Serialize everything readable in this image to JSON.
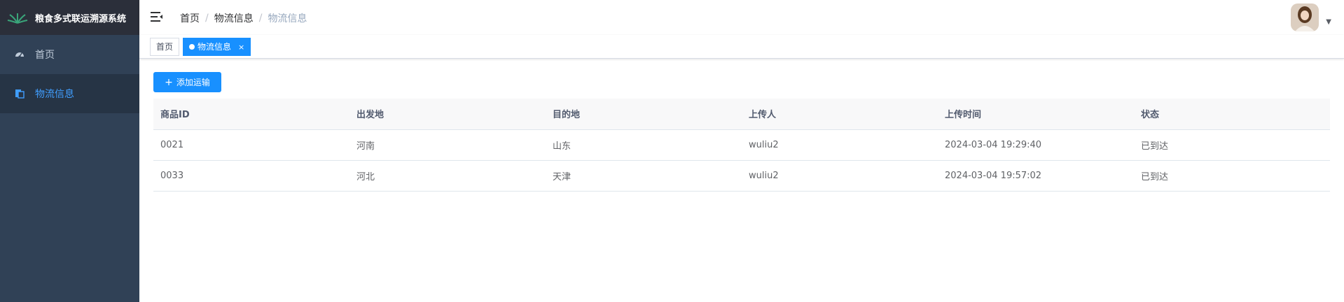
{
  "app": {
    "title": "粮食多式联运溯源系统"
  },
  "sidebar": {
    "items": [
      {
        "label": "首页",
        "icon": "dashboard-icon"
      },
      {
        "label": "物流信息",
        "icon": "documents-icon"
      }
    ]
  },
  "navbar": {
    "breadcrumb": [
      "首页",
      "物流信息",
      "物流信息"
    ],
    "separator": "/"
  },
  "tags": {
    "home": "首页",
    "active": "物流信息",
    "close": "×"
  },
  "toolbar": {
    "add_label": "添加运输",
    "add_icon": "+"
  },
  "table": {
    "columns": [
      "商品ID",
      "出发地",
      "目的地",
      "上传人",
      "上传时间",
      "状态"
    ],
    "rows": [
      [
        "0021",
        "河南",
        "山东",
        "wuliu2",
        "2024-03-04 19:29:40",
        "已到达"
      ],
      [
        "0033",
        "河北",
        "天津",
        "wuliu2",
        "2024-03-04 19:57:02",
        "已到达"
      ]
    ]
  },
  "colors": {
    "sidebar_bg": "#304156",
    "accent": "#1890ff",
    "menu_active_text": "#409eff"
  }
}
